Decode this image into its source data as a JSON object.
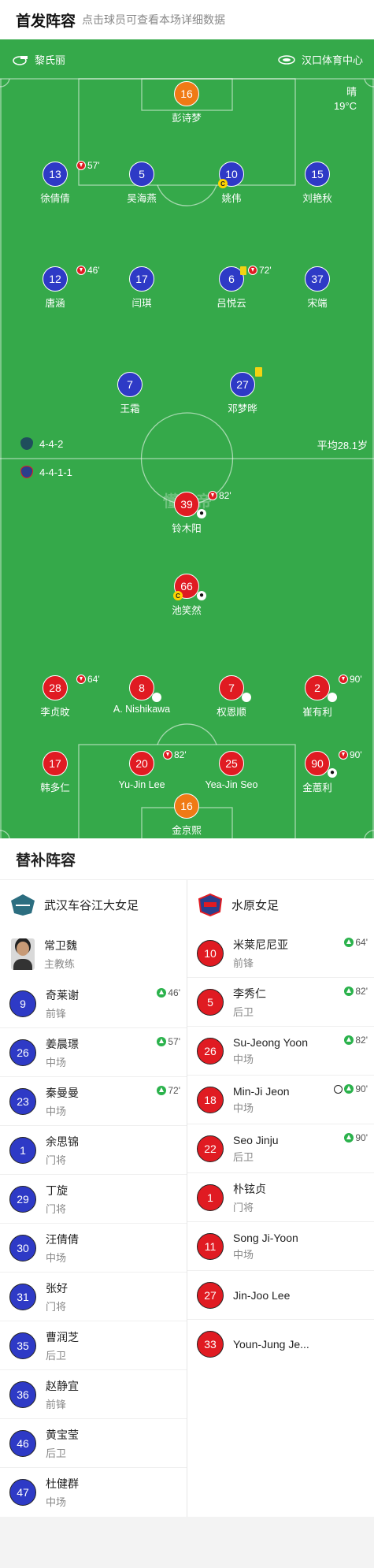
{
  "header": {
    "title": "首发阵容",
    "subtitle": "点击球员可查看本场详细数据"
  },
  "pitch": {
    "referee_icon": "whistle-icon",
    "referee": "黎氏丽",
    "venue_icon": "stadium-icon",
    "venue": "汉口体育中心",
    "weather": "晴",
    "temperature": "19°C",
    "watermark": "懂球帝",
    "home": {
      "formation": "4-4-2",
      "avg_age": "平均28.1岁",
      "color": "#2e3ac6"
    },
    "away": {
      "formation": "4-4-1-1",
      "color": "#e01b22"
    },
    "home_players": [
      {
        "num": "16",
        "name": "彭诗梦",
        "gk": true
      },
      {
        "num": "13",
        "name": "徐倩倩",
        "sub_out": "57'"
      },
      {
        "num": "5",
        "name": "吴海燕"
      },
      {
        "num": "10",
        "name": "姚伟",
        "captain": "C"
      },
      {
        "num": "15",
        "name": "刘艳秋"
      },
      {
        "num": "12",
        "name": "唐涵",
        "sub_out": "46'"
      },
      {
        "num": "17",
        "name": "闫琪"
      },
      {
        "num": "6",
        "name": "吕悦云",
        "yellow": true,
        "sub_out": "72'"
      },
      {
        "num": "37",
        "name": "宋端"
      },
      {
        "num": "7",
        "name": "王霜"
      },
      {
        "num": "27",
        "name": "邓梦晔",
        "yellow": true
      }
    ],
    "away_players": [
      {
        "num": "39",
        "name": "铃木阳",
        "sub_out": "82'",
        "goal": true
      },
      {
        "num": "66",
        "name": "池笑然",
        "captain": "C",
        "goal": true
      },
      {
        "num": "28",
        "name": "李贞旼",
        "sub_out": "64'"
      },
      {
        "num": "8",
        "name": "A. Nishikawa",
        "own_goal": true
      },
      {
        "num": "7",
        "name": "权恩顺",
        "own_goal": true
      },
      {
        "num": "2",
        "name": "崔有利",
        "sub_out": "90'",
        "own_goal": true
      },
      {
        "num": "17",
        "name": "韩多仁"
      },
      {
        "num": "20",
        "name": "Yu-Jin Lee",
        "sub_out": "82'"
      },
      {
        "num": "25",
        "name": "Yea-Jin Seo"
      },
      {
        "num": "90",
        "name": "金蕙利",
        "sub_out": "90'",
        "goal": true
      },
      {
        "num": "16",
        "name": "金京熙",
        "gk": true
      }
    ]
  },
  "subs": {
    "title": "替补阵容",
    "home": {
      "team": "武汉车谷江大女足",
      "coach_name": "常卫魏",
      "coach_role": "主教练",
      "players": [
        {
          "num": "9",
          "name": "奇莱谢",
          "pos": "前锋",
          "time": "46'"
        },
        {
          "num": "26",
          "name": "姜晨璟",
          "pos": "中场",
          "time": "57'"
        },
        {
          "num": "23",
          "name": "秦曼曼",
          "pos": "中场",
          "time": "72'"
        },
        {
          "num": "1",
          "name": "余思锦",
          "pos": "门将"
        },
        {
          "num": "29",
          "name": "丁旋",
          "pos": "门将"
        },
        {
          "num": "30",
          "name": "汪倩倩",
          "pos": "中场"
        },
        {
          "num": "31",
          "name": "张好",
          "pos": "门将"
        },
        {
          "num": "35",
          "name": "曹润芝",
          "pos": "后卫"
        },
        {
          "num": "36",
          "name": "赵静宜",
          "pos": "前锋"
        },
        {
          "num": "46",
          "name": "黄宝莹",
          "pos": "后卫"
        },
        {
          "num": "47",
          "name": "杜健群",
          "pos": "中场"
        }
      ]
    },
    "away": {
      "team": "水原女足",
      "players": [
        {
          "num": "10",
          "name": "米莱尼尼亚",
          "pos": "前锋",
          "time": "64'"
        },
        {
          "num": "5",
          "name": "李秀仁",
          "pos": "后卫",
          "time": "82'"
        },
        {
          "num": "26",
          "name": "Su-Jeong Yoon",
          "pos": "中场",
          "time": "82'"
        },
        {
          "num": "18",
          "name": "Min-Ji Jeon",
          "pos": "中场",
          "time": "90'",
          "goal": true
        },
        {
          "num": "22",
          "name": "Seo Jinju",
          "pos": "后卫",
          "time": "90'"
        },
        {
          "num": "1",
          "name": "朴铉贞",
          "pos": "门将"
        },
        {
          "num": "11",
          "name": "Song Ji-Yoon",
          "pos": "中场"
        },
        {
          "num": "27",
          "name": "Jin-Joo Lee",
          "pos": ""
        },
        {
          "num": "33",
          "name": "Youn-Jung Je...",
          "pos": ""
        }
      ]
    }
  }
}
